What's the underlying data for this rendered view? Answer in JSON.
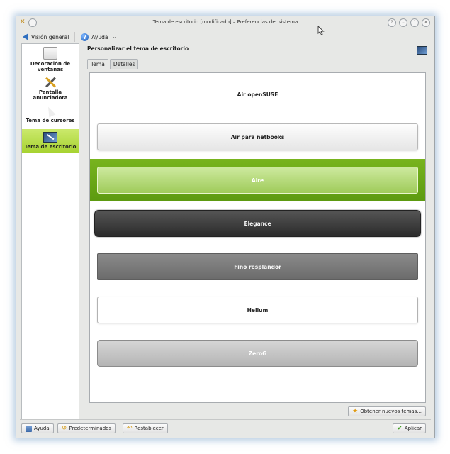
{
  "window": {
    "title": "Tema de escritorio [modificado] – Preferencias del sistema"
  },
  "titlebar_buttons": [
    "?",
    "⌄",
    "⌃",
    "✕"
  ],
  "toolbar": {
    "overview_label": "Visión general",
    "help_label": "Ayuda",
    "help_chevron": "⌄"
  },
  "sidebar": {
    "items": [
      {
        "label": "Decoración de ventanas"
      },
      {
        "label": "Pantalla anunciadora"
      },
      {
        "label": "Tema de cursores"
      },
      {
        "label": "Tema de escritorio"
      }
    ],
    "active_index": 3
  },
  "main": {
    "title": "Personalizar el tema de escritorio",
    "tabs": [
      {
        "label": "Tema"
      },
      {
        "label": "Detalles"
      }
    ],
    "themes": [
      {
        "name": "Air openSUSE"
      },
      {
        "name": "Air para netbooks"
      },
      {
        "name": "Aire"
      },
      {
        "name": "Elegance"
      },
      {
        "name": "Fino resplandor"
      },
      {
        "name": "Helium"
      },
      {
        "name": "ZeroG"
      }
    ],
    "selected_theme": "Aire",
    "get_new_themes_label": "Obtener nuevos temas..."
  },
  "footer": {
    "help_label": "Ayuda",
    "defaults_label": "Predeterminados",
    "reset_label": "Restablecer",
    "apply_label": "Aplicar"
  },
  "colors": {
    "selection": "#6aa816",
    "accent_blue": "#2f6fc0"
  }
}
